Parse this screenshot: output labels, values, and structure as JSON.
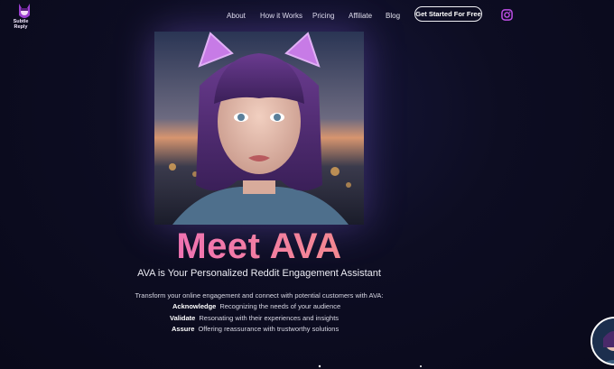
{
  "brand": {
    "name_line1": "Subtle",
    "name_line2": "Reply"
  },
  "nav": {
    "items": [
      {
        "label": "About"
      },
      {
        "label": "How it Works"
      },
      {
        "label": "Pricing"
      },
      {
        "label": "Affiliate"
      },
      {
        "label": "Blog"
      }
    ],
    "cta_label": "Get Started For Free",
    "social_icon": "instagram-icon"
  },
  "hero": {
    "headline": "Meet AVA",
    "subheadline": "AVA is Your Personalized Reddit Engagement Assistant",
    "intro": "Transform your online engagement and connect with potential customers with AVA:",
    "points": [
      {
        "term": "Acknowledge",
        "text": "Recognizing the needs of your audience"
      },
      {
        "term": "Validate",
        "text": "Resonating with their experiences and insights"
      },
      {
        "term": "Assure",
        "text": "Offering reassurance with trustworthy solutions"
      }
    ]
  },
  "colors": {
    "background": "#0b0b1c",
    "headline_gradient_start": "#e65bd0",
    "headline_gradient_end": "#f6a06b",
    "accent_purple": "#b04ee0"
  }
}
